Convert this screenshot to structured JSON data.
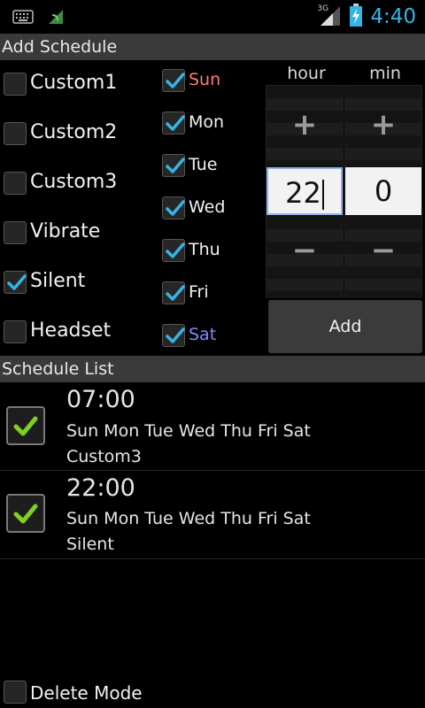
{
  "status_bar": {
    "time": "4:40",
    "network": "3G",
    "icons": [
      "keyboard-icon",
      "sync-icon",
      "network-3g-icon",
      "signal-icon",
      "battery-charging-icon"
    ]
  },
  "add_schedule": {
    "header": "Add Schedule",
    "modes": [
      {
        "label": "Custom1",
        "checked": false
      },
      {
        "label": "Custom2",
        "checked": false
      },
      {
        "label": "Custom3",
        "checked": false
      },
      {
        "label": "Vibrate",
        "checked": false
      },
      {
        "label": "Silent",
        "checked": true
      },
      {
        "label": "Headset",
        "checked": false
      }
    ],
    "days": [
      {
        "label": "Sun",
        "checked": true,
        "color": "#ff7a7a"
      },
      {
        "label": "Mon",
        "checked": true,
        "color": "#f2f2f2"
      },
      {
        "label": "Tue",
        "checked": true,
        "color": "#f2f2f2"
      },
      {
        "label": "Wed",
        "checked": true,
        "color": "#f2f2f2"
      },
      {
        "label": "Thu",
        "checked": true,
        "color": "#f2f2f2"
      },
      {
        "label": "Fri",
        "checked": true,
        "color": "#f2f2f2"
      },
      {
        "label": "Sat",
        "checked": true,
        "color": "#8888ff"
      }
    ],
    "hour_picker": {
      "title": "hour",
      "value": "22",
      "plus": "+",
      "minus": "−"
    },
    "min_picker": {
      "title": "min",
      "value": "0",
      "plus": "+",
      "minus": "−"
    },
    "add_button": "Add"
  },
  "schedule_list": {
    "header": "Schedule List",
    "items": [
      {
        "time": "07:00",
        "days": "Sun Mon Tue Wed Thu Fri Sat",
        "mode": "Custom3",
        "checked": true
      },
      {
        "time": "22:00",
        "days": "Sun Mon Tue Wed Thu Fri Sat",
        "mode": "Silent",
        "checked": true
      }
    ]
  },
  "delete_mode": {
    "label": "Delete Mode",
    "checked": false
  },
  "colors": {
    "accent": "#33b5e5",
    "check_green": "#7fcf1f",
    "header_bg": "#3a3a3a"
  }
}
